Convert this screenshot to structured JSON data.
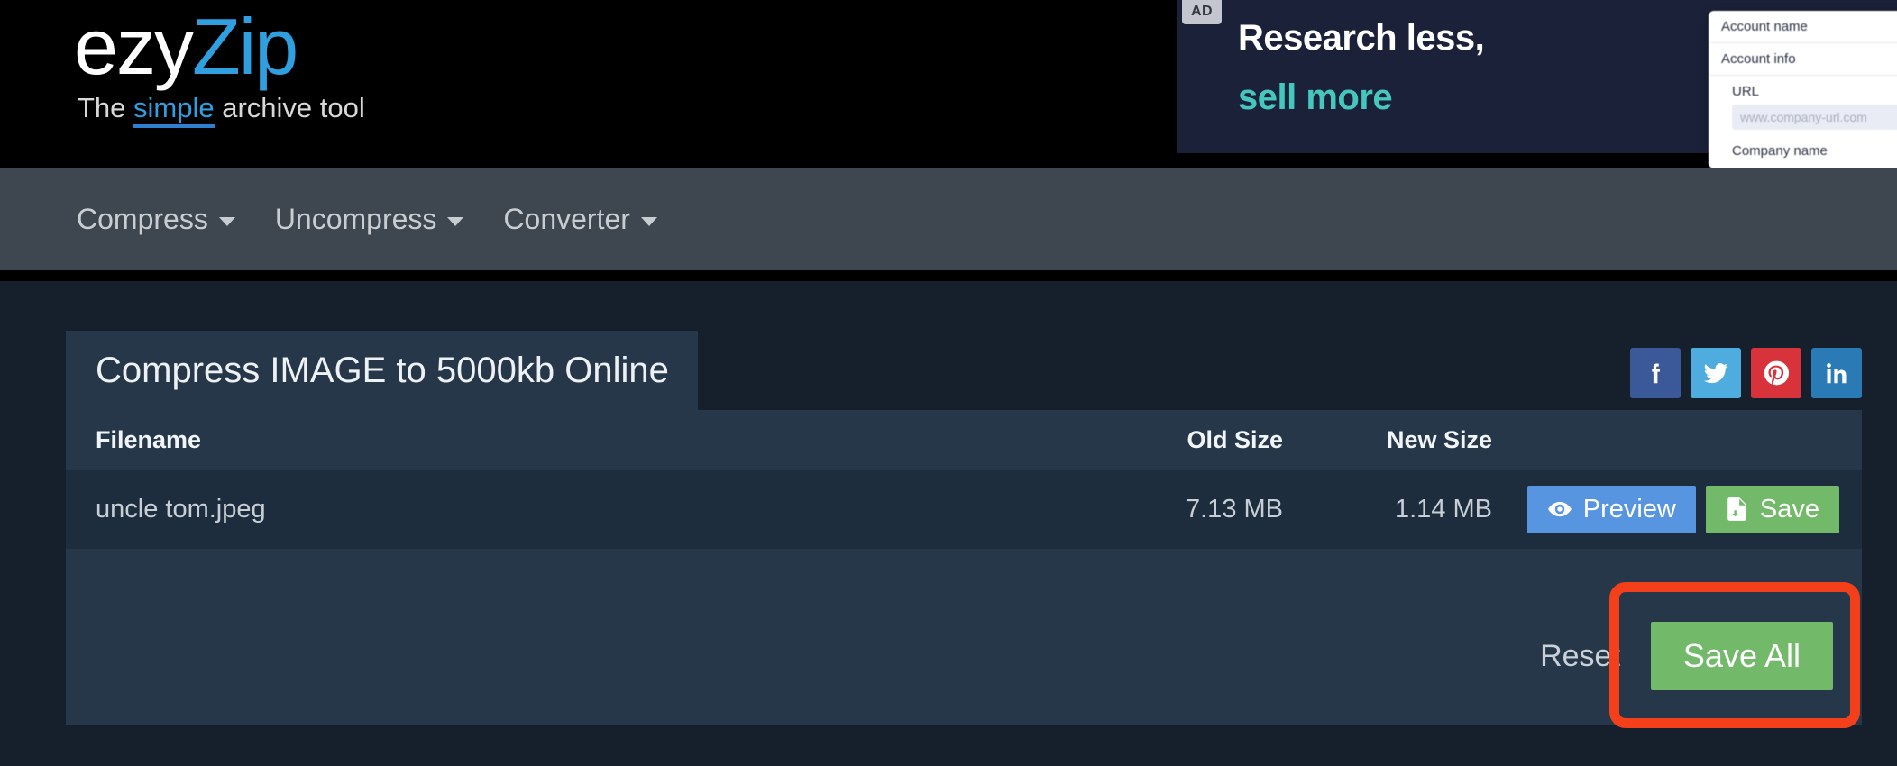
{
  "brand": {
    "name_part1": "ezy",
    "name_part2": "Zip",
    "tagline_pre": "The ",
    "tagline_accent": "simple",
    "tagline_post": " archive tool",
    "accent_color": "#2f9fe0"
  },
  "ad": {
    "label": "AD",
    "headline_line1": "Research less,",
    "headline_line2": "sell more",
    "accent_color": "#45c7bd",
    "mock": {
      "row1": "Account name",
      "row2": "Account info",
      "row3": "URL",
      "input_placeholder": "www.company-url.com",
      "row4": "Company name"
    }
  },
  "navbar": {
    "items": [
      {
        "label": "Compress",
        "icon": "chevron-down-icon"
      },
      {
        "label": "Uncompress",
        "icon": "chevron-down-icon"
      },
      {
        "label": "Converter",
        "icon": "chevron-down-icon"
      }
    ]
  },
  "card": {
    "title": "Compress IMAGE to 5000kb Online",
    "social": [
      {
        "name": "facebook",
        "glyph": "f",
        "color": "#3b5998"
      },
      {
        "name": "twitter",
        "glyph": "t",
        "color": "#4eadde"
      },
      {
        "name": "pinterest",
        "glyph": "p",
        "color": "#d8323a"
      },
      {
        "name": "linkedin",
        "glyph": "in",
        "color": "#2a7bb5"
      }
    ],
    "table": {
      "headers": {
        "filename": "Filename",
        "old_size": "Old Size",
        "new_size": "New Size"
      },
      "rows": [
        {
          "filename": "uncle tom.jpeg",
          "old_size": "7.13 MB",
          "new_size": "1.14 MB",
          "preview_label": "Preview",
          "save_label": "Save"
        }
      ]
    },
    "footer": {
      "reset_label": "Reset",
      "save_all_label": "Save All",
      "highlight_color": "#f4401a"
    }
  }
}
